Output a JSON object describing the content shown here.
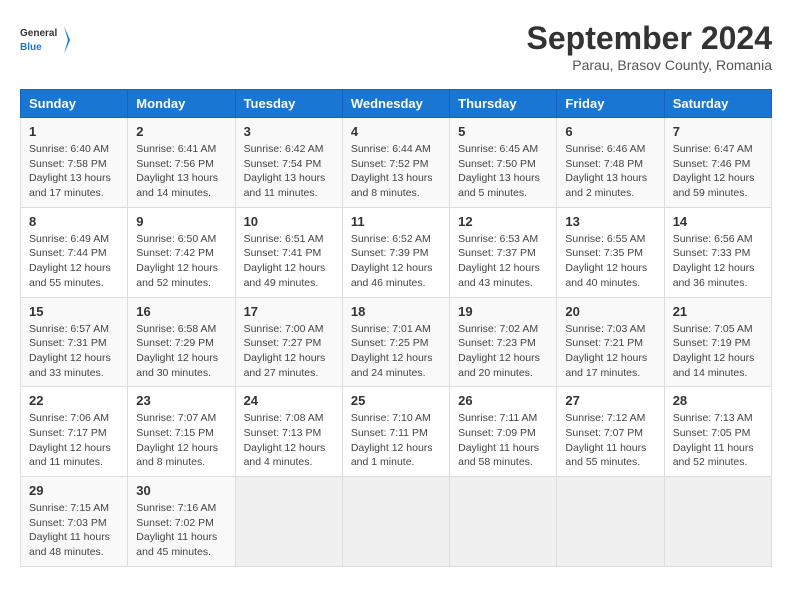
{
  "logo": {
    "general": "General",
    "blue": "Blue"
  },
  "title": "September 2024",
  "subtitle": "Parau, Brasov County, Romania",
  "weekdays": [
    "Sunday",
    "Monday",
    "Tuesday",
    "Wednesday",
    "Thursday",
    "Friday",
    "Saturday"
  ],
  "weeks": [
    [
      {
        "day": "1",
        "info": "Sunrise: 6:40 AM\nSunset: 7:58 PM\nDaylight: 13 hours and 17 minutes."
      },
      {
        "day": "2",
        "info": "Sunrise: 6:41 AM\nSunset: 7:56 PM\nDaylight: 13 hours and 14 minutes."
      },
      {
        "day": "3",
        "info": "Sunrise: 6:42 AM\nSunset: 7:54 PM\nDaylight: 13 hours and 11 minutes."
      },
      {
        "day": "4",
        "info": "Sunrise: 6:44 AM\nSunset: 7:52 PM\nDaylight: 13 hours and 8 minutes."
      },
      {
        "day": "5",
        "info": "Sunrise: 6:45 AM\nSunset: 7:50 PM\nDaylight: 13 hours and 5 minutes."
      },
      {
        "day": "6",
        "info": "Sunrise: 6:46 AM\nSunset: 7:48 PM\nDaylight: 13 hours and 2 minutes."
      },
      {
        "day": "7",
        "info": "Sunrise: 6:47 AM\nSunset: 7:46 PM\nDaylight: 12 hours and 59 minutes."
      }
    ],
    [
      {
        "day": "8",
        "info": "Sunrise: 6:49 AM\nSunset: 7:44 PM\nDaylight: 12 hours and 55 minutes."
      },
      {
        "day": "9",
        "info": "Sunrise: 6:50 AM\nSunset: 7:42 PM\nDaylight: 12 hours and 52 minutes."
      },
      {
        "day": "10",
        "info": "Sunrise: 6:51 AM\nSunset: 7:41 PM\nDaylight: 12 hours and 49 minutes."
      },
      {
        "day": "11",
        "info": "Sunrise: 6:52 AM\nSunset: 7:39 PM\nDaylight: 12 hours and 46 minutes."
      },
      {
        "day": "12",
        "info": "Sunrise: 6:53 AM\nSunset: 7:37 PM\nDaylight: 12 hours and 43 minutes."
      },
      {
        "day": "13",
        "info": "Sunrise: 6:55 AM\nSunset: 7:35 PM\nDaylight: 12 hours and 40 minutes."
      },
      {
        "day": "14",
        "info": "Sunrise: 6:56 AM\nSunset: 7:33 PM\nDaylight: 12 hours and 36 minutes."
      }
    ],
    [
      {
        "day": "15",
        "info": "Sunrise: 6:57 AM\nSunset: 7:31 PM\nDaylight: 12 hours and 33 minutes."
      },
      {
        "day": "16",
        "info": "Sunrise: 6:58 AM\nSunset: 7:29 PM\nDaylight: 12 hours and 30 minutes."
      },
      {
        "day": "17",
        "info": "Sunrise: 7:00 AM\nSunset: 7:27 PM\nDaylight: 12 hours and 27 minutes."
      },
      {
        "day": "18",
        "info": "Sunrise: 7:01 AM\nSunset: 7:25 PM\nDaylight: 12 hours and 24 minutes."
      },
      {
        "day": "19",
        "info": "Sunrise: 7:02 AM\nSunset: 7:23 PM\nDaylight: 12 hours and 20 minutes."
      },
      {
        "day": "20",
        "info": "Sunrise: 7:03 AM\nSunset: 7:21 PM\nDaylight: 12 hours and 17 minutes."
      },
      {
        "day": "21",
        "info": "Sunrise: 7:05 AM\nSunset: 7:19 PM\nDaylight: 12 hours and 14 minutes."
      }
    ],
    [
      {
        "day": "22",
        "info": "Sunrise: 7:06 AM\nSunset: 7:17 PM\nDaylight: 12 hours and 11 minutes."
      },
      {
        "day": "23",
        "info": "Sunrise: 7:07 AM\nSunset: 7:15 PM\nDaylight: 12 hours and 8 minutes."
      },
      {
        "day": "24",
        "info": "Sunrise: 7:08 AM\nSunset: 7:13 PM\nDaylight: 12 hours and 4 minutes."
      },
      {
        "day": "25",
        "info": "Sunrise: 7:10 AM\nSunset: 7:11 PM\nDaylight: 12 hours and 1 minute."
      },
      {
        "day": "26",
        "info": "Sunrise: 7:11 AM\nSunset: 7:09 PM\nDaylight: 11 hours and 58 minutes."
      },
      {
        "day": "27",
        "info": "Sunrise: 7:12 AM\nSunset: 7:07 PM\nDaylight: 11 hours and 55 minutes."
      },
      {
        "day": "28",
        "info": "Sunrise: 7:13 AM\nSunset: 7:05 PM\nDaylight: 11 hours and 52 minutes."
      }
    ],
    [
      {
        "day": "29",
        "info": "Sunrise: 7:15 AM\nSunset: 7:03 PM\nDaylight: 11 hours and 48 minutes."
      },
      {
        "day": "30",
        "info": "Sunrise: 7:16 AM\nSunset: 7:02 PM\nDaylight: 11 hours and 45 minutes."
      },
      {
        "day": "",
        "info": ""
      },
      {
        "day": "",
        "info": ""
      },
      {
        "day": "",
        "info": ""
      },
      {
        "day": "",
        "info": ""
      },
      {
        "day": "",
        "info": ""
      }
    ]
  ]
}
